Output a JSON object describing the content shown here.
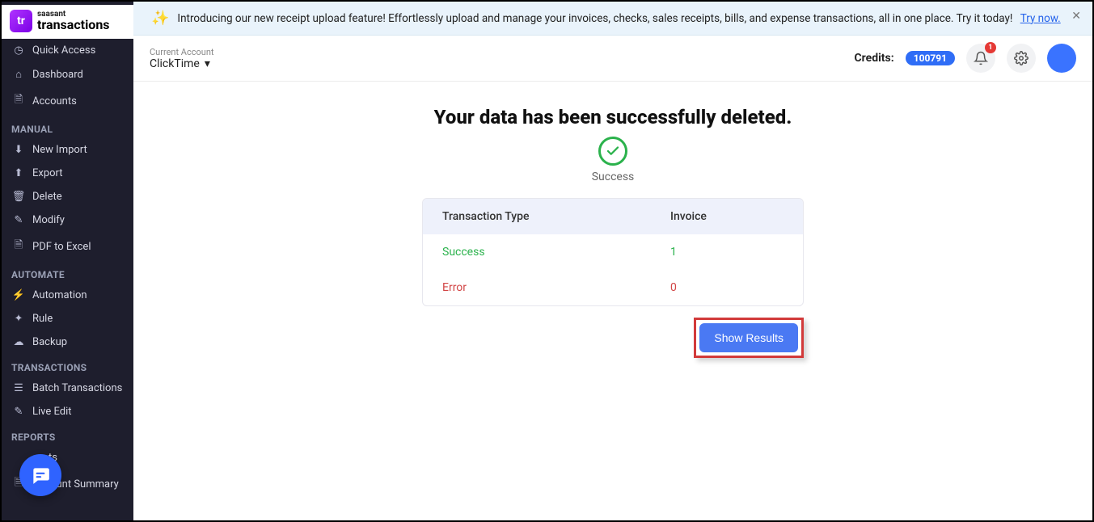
{
  "logo": {
    "icon_text": "tr",
    "brand": "saasant",
    "product": "transactions"
  },
  "sidebar": {
    "top": [
      {
        "label": "Quick Access"
      },
      {
        "label": "Dashboard"
      },
      {
        "label": "Accounts"
      }
    ],
    "manual_title": "MANUAL",
    "manual": [
      {
        "label": "New Import"
      },
      {
        "label": "Export"
      },
      {
        "label": "Delete"
      },
      {
        "label": "Modify"
      },
      {
        "label": "PDF to Excel"
      }
    ],
    "automate_title": "AUTOMATE",
    "automate": [
      {
        "label": "Automation"
      },
      {
        "label": "Rule"
      },
      {
        "label": "Backup"
      }
    ],
    "transactions_title": "TRANSACTIONS",
    "transactions": [
      {
        "label": "Batch Transactions"
      },
      {
        "label": "Live Edit"
      }
    ],
    "reports_title": "REPORTS",
    "reports": [
      {
        "label": "ts"
      },
      {
        "label": "Account Summary"
      }
    ]
  },
  "banner": {
    "text": "Introducing our new receipt upload feature! Effortlessly upload and manage your invoices, checks, sales receipts, bills, and expense transactions, all in one place. Try it today!",
    "link": "Try now."
  },
  "topbar": {
    "account_label": "Current Account",
    "account_name": "ClickTime",
    "credits_label": "Credits:",
    "credits_value": "100791",
    "notif_count": "1"
  },
  "result": {
    "headline": "Your data has been successfully deleted.",
    "sub": "Success",
    "header_col1": "Transaction Type",
    "header_col2": "Invoice",
    "success_label": "Success",
    "success_value": "1",
    "error_label": "Error",
    "error_value": "0",
    "button": "Show Results"
  }
}
